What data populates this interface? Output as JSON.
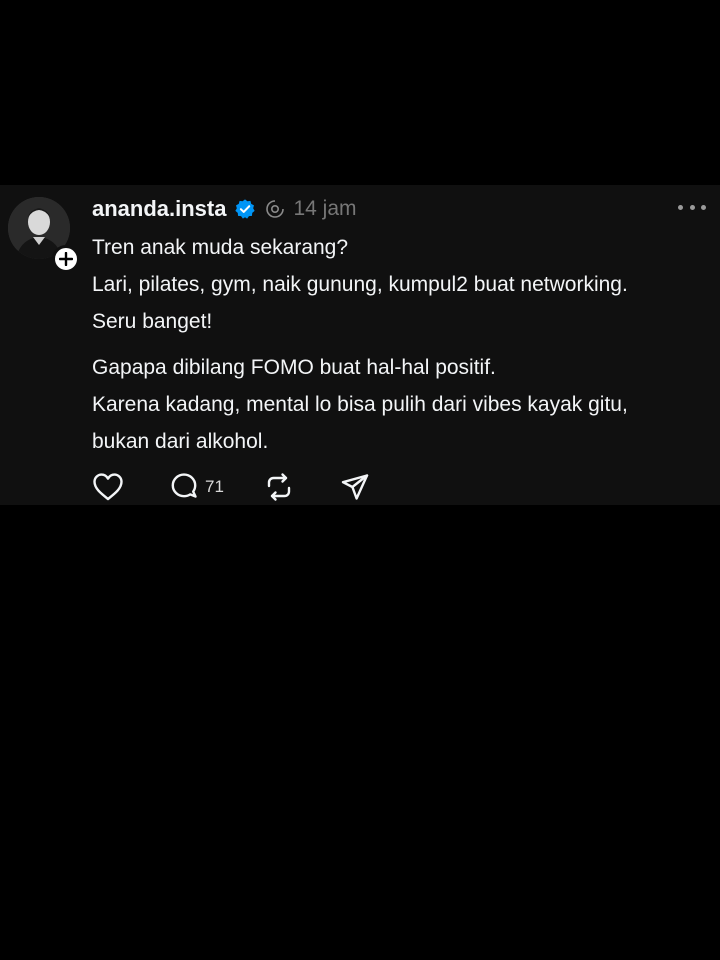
{
  "post": {
    "username": "ananda.insta",
    "timestamp": "14 jam",
    "verified": true,
    "lines": [
      "Tren anak muda sekarang?",
      "Lari, pilates, gym, naik gunung, kumpul2 buat networking.",
      "Seru banget!",
      "Gapapa dibilang FOMO buat hal-hal positif.",
      "Karena kadang, mental lo bisa pulih dari vibes kayak gitu,",
      "bukan dari alkohol."
    ],
    "reply_count": "71"
  },
  "icons": {
    "verified": "verified-badge-icon",
    "boost": "boost-icon",
    "more": "more-icon",
    "like": "heart-icon",
    "reply": "comment-icon",
    "repost": "repost-icon",
    "share": "send-icon",
    "follow": "plus-icon"
  },
  "colors": {
    "background": "#000000",
    "card": "#101010",
    "text": "#f3f5f7",
    "muted": "#777777",
    "verified": "#0095f6"
  }
}
